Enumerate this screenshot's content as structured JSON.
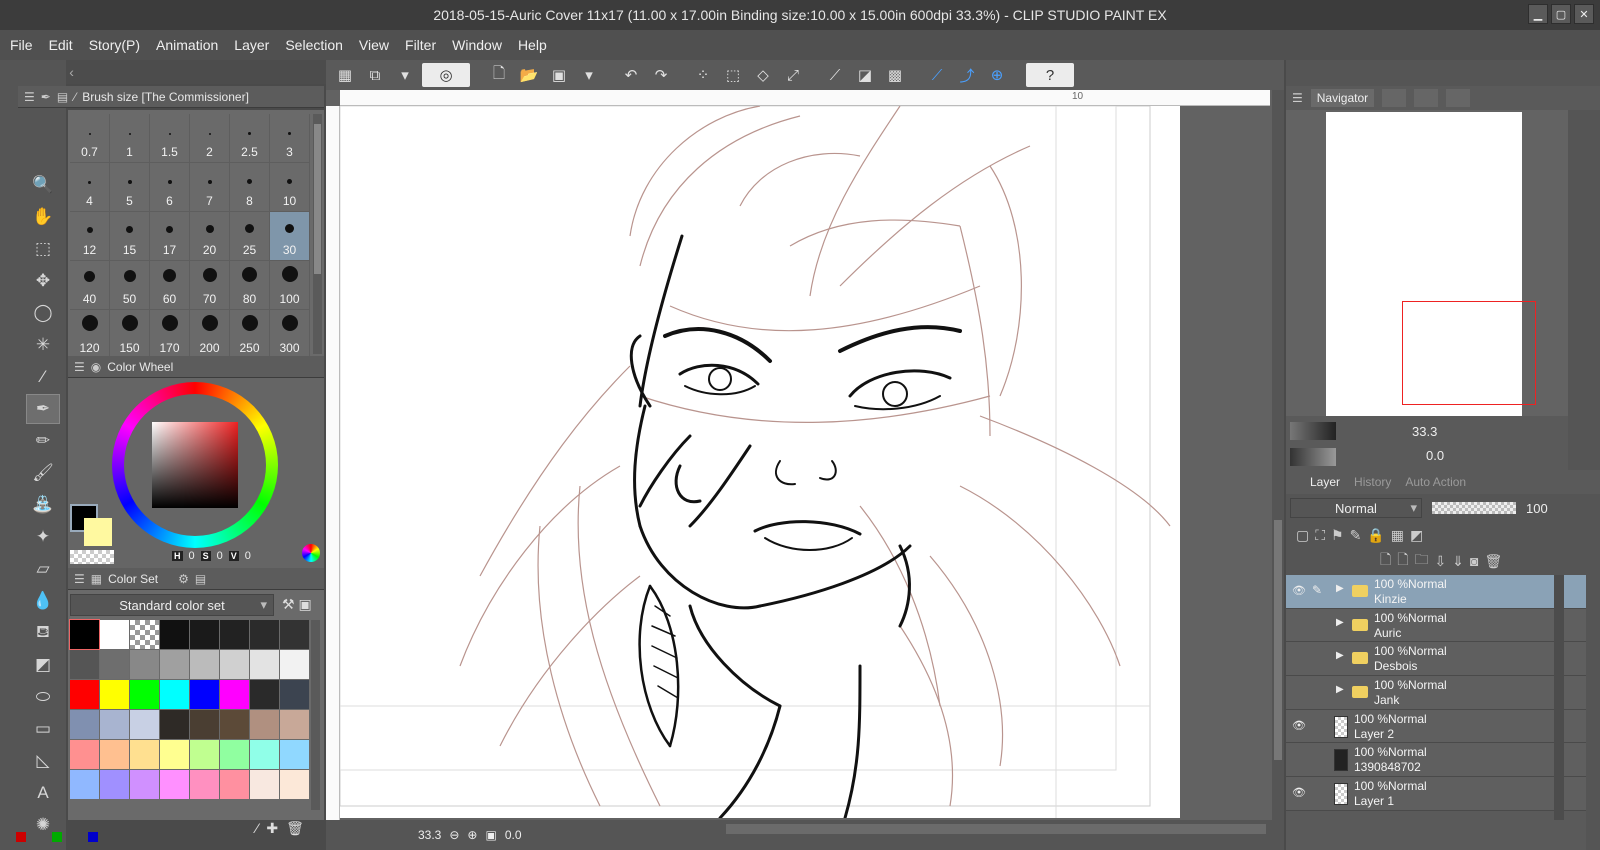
{
  "window": {
    "title": "2018-05-15-Auric Cover 11x17 (11.00 x 17.00in Binding size:10.00 x 15.00in 600dpi 33.3%)  - CLIP STUDIO PAINT EX",
    "min": "▁",
    "max": "▢",
    "close": "✕"
  },
  "menu": [
    "File",
    "Edit",
    "Story(P)",
    "Animation",
    "Layer",
    "Selection",
    "View",
    "Filter",
    "Window",
    "Help"
  ],
  "brush_panel": {
    "title": "Brush size [The Commissioner]",
    "sizes": [
      "0.7",
      "1",
      "1.5",
      "2",
      "2.5",
      "3",
      "4",
      "5",
      "6",
      "7",
      "8",
      "10",
      "12",
      "15",
      "17",
      "20",
      "25",
      "30",
      "40",
      "50",
      "60",
      "70",
      "80",
      "100",
      "120",
      "150",
      "170",
      "200",
      "250",
      "300"
    ],
    "selected": "30"
  },
  "color_wheel": {
    "title": "Color Wheel",
    "h_label": "H",
    "h": "0",
    "s_label": "S",
    "s": "0",
    "v_label": "V",
    "v": "0",
    "main_color": "#000000",
    "sub_color": "#fff9a0"
  },
  "color_set": {
    "title": "Color Set",
    "set_name": "Standard color set",
    "swatches": [
      "#000000",
      "#ffffff",
      "checker",
      "#111111",
      "#1a1a1a",
      "#222222",
      "#2b2b2b",
      "#333333",
      "#555555",
      "#6e6e6e",
      "#888888",
      "#a0a0a0",
      "#bbbbbb",
      "#d0d0d0",
      "#e3e3e3",
      "#f2f2f2",
      "#ff0000",
      "#ffff00",
      "#00ff00",
      "#00ffff",
      "#0000ff",
      "#ff00ff",
      "#2a2a2a",
      "#3c4450",
      "#8090b0",
      "#a8b4d0",
      "#c8d0e4",
      "#2e2a26",
      "#4a3e32",
      "#5c4a38",
      "#b09080",
      "#c8a898",
      "#ff9090",
      "#ffc090",
      "#ffe090",
      "#ffff90",
      "#c0ff90",
      "#90ffa0",
      "#90ffe8",
      "#90d8ff",
      "#90b8ff",
      "#a090ff",
      "#d090ff",
      "#ff90ff",
      "#ff90c0",
      "#ff90a0",
      "#f8e8e0",
      "#fce8d8"
    ]
  },
  "navigator": {
    "title": "Navigator",
    "zoom": "33.3",
    "rotation": "0.0"
  },
  "layer_panel": {
    "tabs": [
      "Layer",
      "History",
      "Auto Action"
    ],
    "blend_mode": "Normal",
    "opacity": "100",
    "layers": [
      {
        "percent": "100 %Normal",
        "name": "Kinzie",
        "type": "folder",
        "visible": true,
        "selected": true
      },
      {
        "percent": "100 %Normal",
        "name": "Auric",
        "type": "folder",
        "visible": false,
        "selected": false
      },
      {
        "percent": "100 %Normal",
        "name": "Desbois",
        "type": "folder",
        "visible": false,
        "selected": false
      },
      {
        "percent": "100 %Normal",
        "name": "Jank",
        "type": "folder",
        "visible": false,
        "selected": false
      },
      {
        "percent": "100 %Normal",
        "name": "Layer 2",
        "type": "raster",
        "visible": true,
        "selected": false
      },
      {
        "percent": "100 %Normal",
        "name": "1390848702",
        "type": "image",
        "visible": false,
        "selected": false
      },
      {
        "percent": "100 %Normal",
        "name": "Layer 1",
        "type": "raster",
        "visible": true,
        "selected": false
      }
    ]
  },
  "canvas": {
    "ruler_mark": "10"
  },
  "status": {
    "zoom": "33.3",
    "angle": "0.0"
  },
  "icons": {
    "eye": "👁",
    "pen": "✎",
    "expand": "▶",
    "help": "?"
  }
}
